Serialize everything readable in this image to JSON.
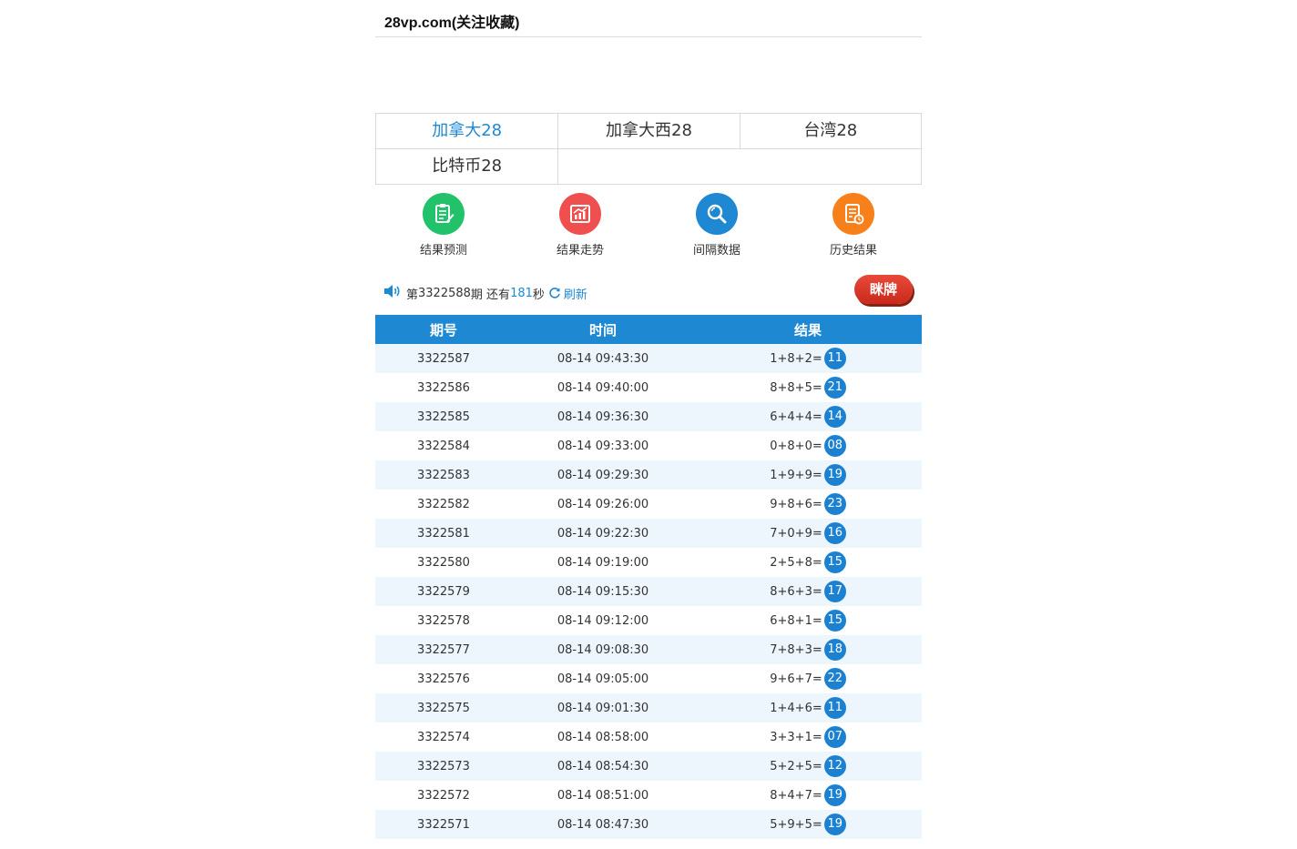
{
  "header": {
    "title": "28vp.com(关注收藏)"
  },
  "lottery_tabs": [
    {
      "label": "加拿大28",
      "active": true
    },
    {
      "label": "加拿大西28",
      "active": false
    },
    {
      "label": "台湾28",
      "active": false
    },
    {
      "label": "比特币28",
      "active": false
    }
  ],
  "menu": [
    {
      "label": "结果预测",
      "icon": "clipboard-icon",
      "color": "#22c26a"
    },
    {
      "label": "结果走势",
      "icon": "trend-chart-icon",
      "color": "#ef4f4f"
    },
    {
      "label": "间隔数据",
      "icon": "magnifier-icon",
      "color": "#1e88d3"
    },
    {
      "label": "历史结果",
      "icon": "history-doc-icon",
      "color": "#f7801b"
    }
  ],
  "status": {
    "prefix": "第",
    "issue": "3322588",
    "middle": "期 还有",
    "seconds": "181",
    "suffix": "秒",
    "refresh_label": "刷新",
    "reveal_button": "眯牌"
  },
  "table": {
    "headers": [
      "期号",
      "时间",
      "结果"
    ],
    "rows": [
      {
        "issue": "3322587",
        "time": "08-14 09:43:30",
        "formula": "1+8+2=",
        "sum": "11"
      },
      {
        "issue": "3322586",
        "time": "08-14 09:40:00",
        "formula": "8+8+5=",
        "sum": "21"
      },
      {
        "issue": "3322585",
        "time": "08-14 09:36:30",
        "formula": "6+4+4=",
        "sum": "14"
      },
      {
        "issue": "3322584",
        "time": "08-14 09:33:00",
        "formula": "0+8+0=",
        "sum": "08"
      },
      {
        "issue": "3322583",
        "time": "08-14 09:29:30",
        "formula": "1+9+9=",
        "sum": "19"
      },
      {
        "issue": "3322582",
        "time": "08-14 09:26:00",
        "formula": "9+8+6=",
        "sum": "23"
      },
      {
        "issue": "3322581",
        "time": "08-14 09:22:30",
        "formula": "7+0+9=",
        "sum": "16"
      },
      {
        "issue": "3322580",
        "time": "08-14 09:19:00",
        "formula": "2+5+8=",
        "sum": "15"
      },
      {
        "issue": "3322579",
        "time": "08-14 09:15:30",
        "formula": "8+6+3=",
        "sum": "17"
      },
      {
        "issue": "3322578",
        "time": "08-14 09:12:00",
        "formula": "6+8+1=",
        "sum": "15"
      },
      {
        "issue": "3322577",
        "time": "08-14 09:08:30",
        "formula": "7+8+3=",
        "sum": "18"
      },
      {
        "issue": "3322576",
        "time": "08-14 09:05:00",
        "formula": "9+6+7=",
        "sum": "22"
      },
      {
        "issue": "3322575",
        "time": "08-14 09:01:30",
        "formula": "1+4+6=",
        "sum": "11"
      },
      {
        "issue": "3322574",
        "time": "08-14 08:58:00",
        "formula": "3+3+1=",
        "sum": "07"
      },
      {
        "issue": "3322573",
        "time": "08-14 08:54:30",
        "formula": "5+2+5=",
        "sum": "12"
      },
      {
        "issue": "3322572",
        "time": "08-14 08:51:00",
        "formula": "8+4+7=",
        "sum": "19"
      },
      {
        "issue": "3322571",
        "time": "08-14 08:47:30",
        "formula": "5+9+5=",
        "sum": "19"
      }
    ]
  }
}
